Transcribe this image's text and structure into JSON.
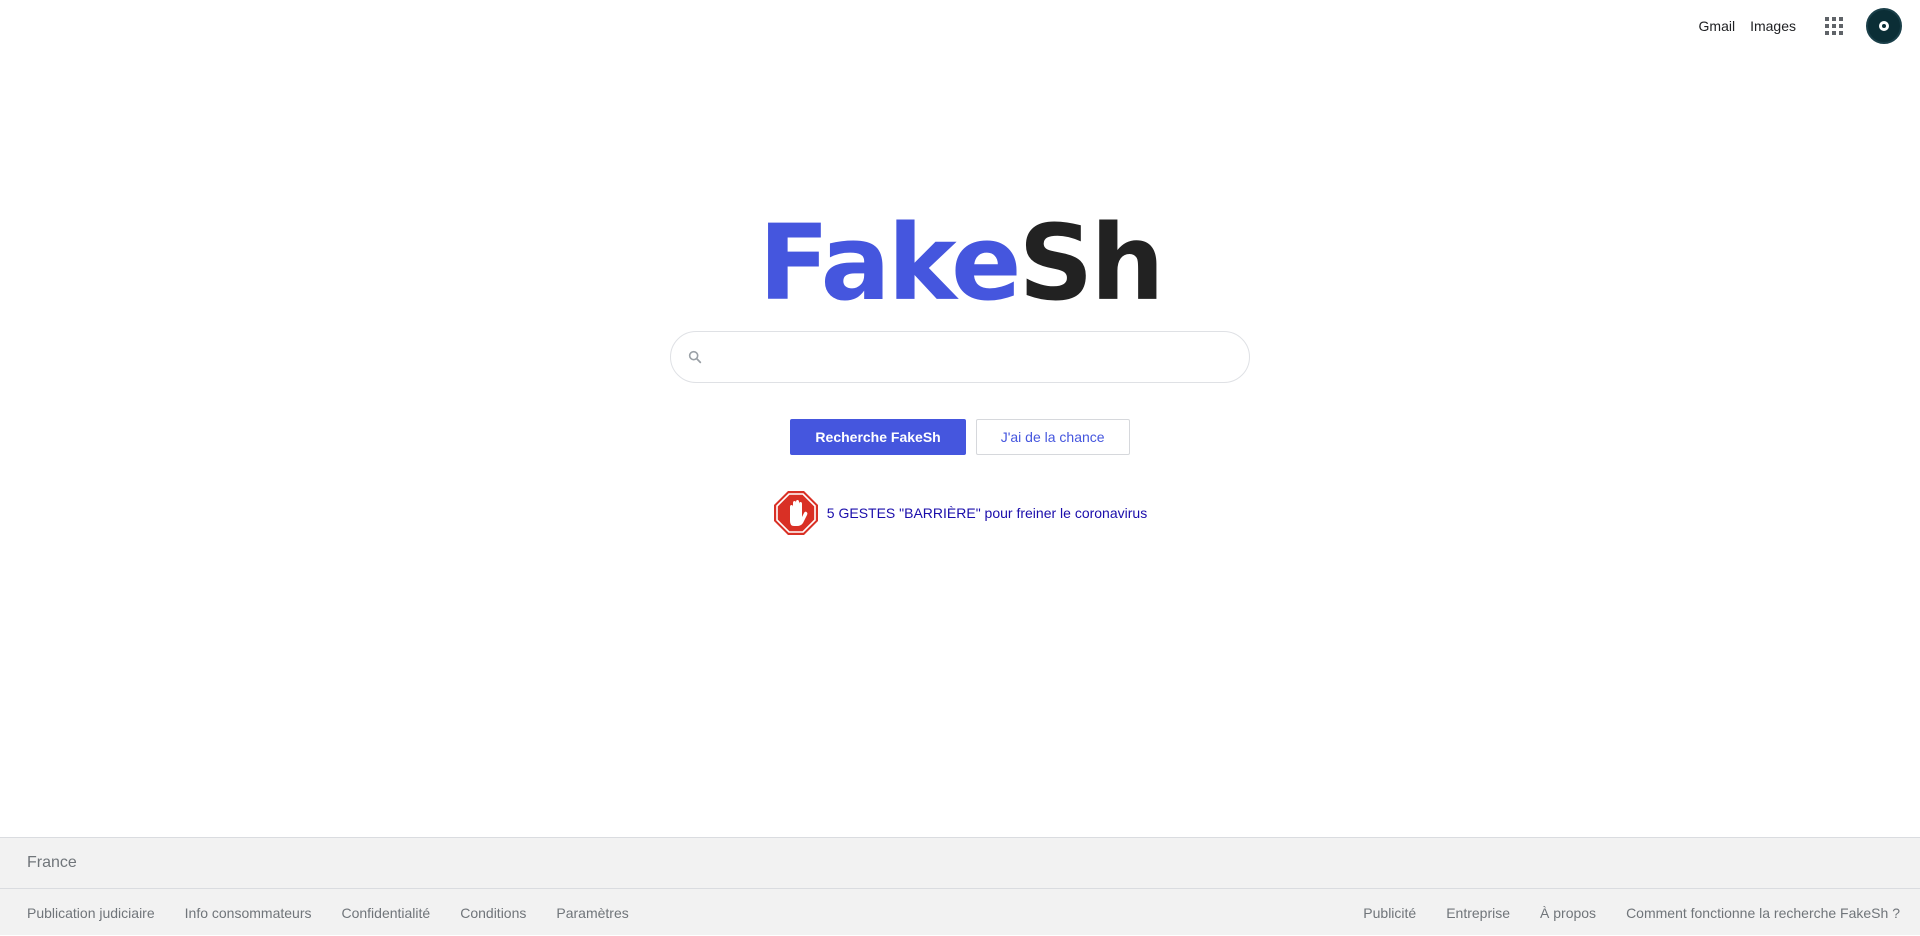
{
  "header": {
    "links": [
      "Gmail",
      "Images"
    ],
    "apps_icon": "apps-grid-icon",
    "avatar_icon": "account-avatar"
  },
  "logo": {
    "part1": "Fake",
    "part2": "Sh",
    "color1": "#4556de",
    "color2": "#222222"
  },
  "search": {
    "value": "",
    "placeholder": "",
    "icon": "search-icon"
  },
  "buttons": {
    "search_label": "Recherche FakeSh",
    "lucky_label": "J'ai de la chance"
  },
  "promo": {
    "icon": "stop-hand-icon",
    "text": "5 GESTES \"BARRIÈRE\" pour freiner le coronavirus"
  },
  "footer": {
    "country": "France",
    "left_links": [
      "Publication judiciaire",
      "Info consommateurs",
      "Confidentialité",
      "Conditions",
      "Paramètres"
    ],
    "right_links": [
      "Publicité",
      "Entreprise",
      "À propos",
      "Comment fonctionne la recherche FakeSh ?"
    ]
  }
}
